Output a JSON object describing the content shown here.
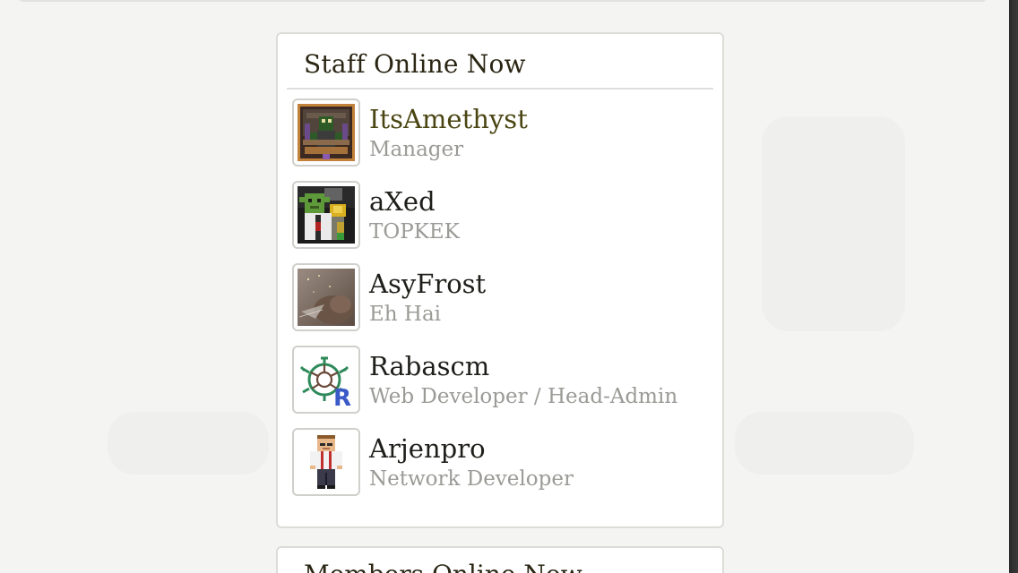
{
  "staff_widget": {
    "title": "Staff Online Now",
    "members": [
      {
        "name": "ItsAmethyst",
        "role": "Manager",
        "avatar_icon": "minecraft-skin-avatar-icon"
      },
      {
        "name": "aXed",
        "role": "TOPKEK",
        "avatar_icon": "goblin-avatar-icon"
      },
      {
        "name": "AsyFrost",
        "role": "Eh Hai",
        "avatar_icon": "cat-photo-avatar-icon"
      },
      {
        "name": "Rabascm",
        "role": "Web Developer / Head-Admin",
        "avatar_icon": "turtle-logo-avatar-icon"
      },
      {
        "name": "Arjenpro",
        "role": "Network Developer",
        "avatar_icon": "minecraft-character-avatar-icon"
      }
    ]
  },
  "members_widget": {
    "title": "Members Online Now"
  },
  "colors": {
    "highlight_name": "#4a4512",
    "title": "#2b2614",
    "role": "#9a9a96"
  }
}
